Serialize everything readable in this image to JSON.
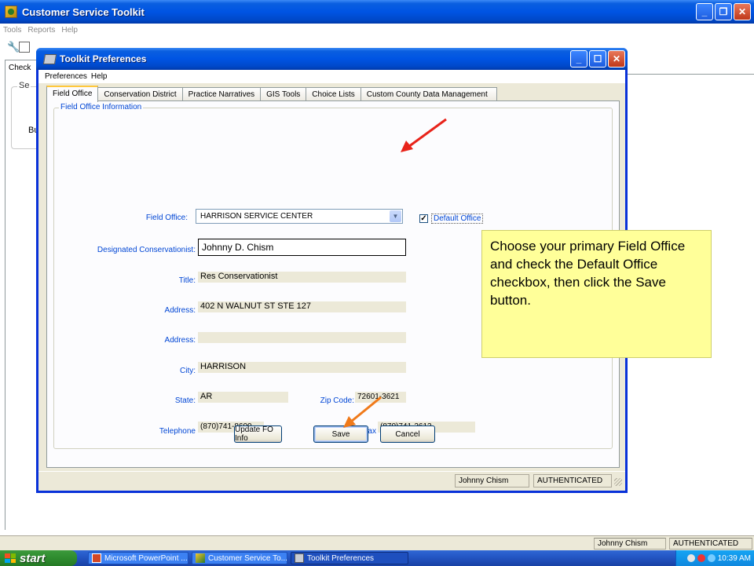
{
  "main_window": {
    "title": "Customer Service Toolkit",
    "menu": [
      "Tools",
      "Reports",
      "Help"
    ],
    "tab_fragment": "Check",
    "group_fragment": "Se",
    "button_fragment": "Bu",
    "status": {
      "user": "Johnny Chism",
      "auth": "AUTHENTICATED"
    },
    "window_buttons": {
      "minimize": "_",
      "maximize": "❐",
      "close": "✕"
    }
  },
  "dialog": {
    "title": "Toolkit Preferences",
    "menu": [
      "Preferences",
      "Help"
    ],
    "window_buttons": {
      "minimize": "_",
      "maximize": "☐",
      "close": "✕"
    },
    "tabs": [
      "Field Office",
      "Conservation District",
      "Practice Narratives",
      "GIS Tools",
      "Choice Lists",
      "Custom County Data Management"
    ],
    "active_tab": 0,
    "section_legend": "Field Office Information",
    "labels": {
      "field_office": "Field Office:",
      "designated_conservationist": "Designated Conservationist:",
      "title": "Title:",
      "address1": "Address:",
      "address2": "Address:",
      "city": "City:",
      "state": "State:",
      "zip": "Zip Code:",
      "telephone": "Telephone",
      "fax": "Fax"
    },
    "values": {
      "field_office": "HARRISON SERVICE CENTER",
      "designated_conservationist": "Johnny D. Chism",
      "title": "Res Conservationist",
      "address1": "402 N WALNUT ST STE 127",
      "address2": "",
      "city": "HARRISON",
      "state": "AR",
      "zip": "72601-3621",
      "telephone": "(870)741-8600",
      "fax": "(870)741-2613"
    },
    "default_office": {
      "label": "Default Office",
      "checked": true,
      "mark": "✓"
    },
    "buttons": {
      "update": "Update FO Info",
      "save": "Save",
      "cancel": "Cancel"
    },
    "status": {
      "user": "Johnny Chism",
      "auth": "AUTHENTICATED"
    }
  },
  "callout": {
    "text": "Choose your primary Field Office and check the Default Office checkbox, then click the Save button."
  },
  "taskbar": {
    "start": "start",
    "buttons": [
      "Microsoft PowerPoint ...",
      "Customer Service To...",
      "Toolkit Preferences"
    ],
    "active_button": 2,
    "clock": "10:39 AM"
  },
  "colors": {
    "title_bar": "#0054e3",
    "label_blue": "#0046d5",
    "callout_bg": "#ffff99",
    "arrow_red": "#e8231a",
    "arrow_orange": "#f07a1a",
    "start_green": "#2e8b2e",
    "dialog_face": "#ece9d8"
  }
}
